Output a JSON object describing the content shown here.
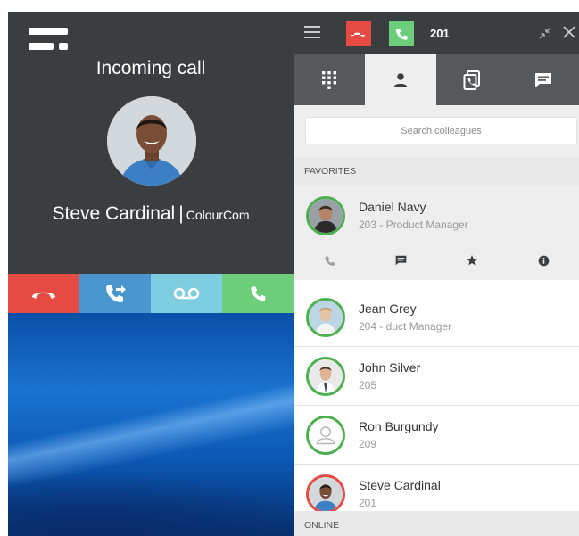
{
  "popup": {
    "title": "Incoming call",
    "caller_name": "Steve Cardinal",
    "separator": "|",
    "caller_company": "ColourCom",
    "actions": [
      {
        "id": "hangup",
        "icon": "hangup-icon",
        "color": "#e54b42"
      },
      {
        "id": "transfer",
        "icon": "transfer-call-icon",
        "color": "#4a97d0"
      },
      {
        "id": "voicemail",
        "icon": "voicemail-icon",
        "color": "#7fcde0"
      },
      {
        "id": "answer",
        "icon": "phone-icon",
        "color": "#6cce7a"
      }
    ]
  },
  "softphone": {
    "topbar": {
      "hangup_color": "#e54b42",
      "answer_color": "#6cce7a",
      "extension": "201"
    },
    "tabs": [
      {
        "id": "keypad",
        "icon": "keypad-icon",
        "active": false
      },
      {
        "id": "contacts",
        "icon": "contact-icon",
        "active": true
      },
      {
        "id": "history",
        "icon": "call-history-icon",
        "active": false
      },
      {
        "id": "chat",
        "icon": "chat-icon",
        "active": false
      }
    ],
    "search": {
      "placeholder": "Search colleagues",
      "value": ""
    },
    "sections": {
      "favorites": "FAVORITES",
      "online": "ONLINE"
    },
    "favorites": [
      {
        "name": "Daniel Navy",
        "detail": "203 - Product Manager",
        "status": "available",
        "status_color": "#4caf50",
        "expanded": true
      },
      {
        "name": "Jean Grey",
        "detail": "204 - duct Manager",
        "status": "available",
        "status_color": "#4caf50",
        "expanded": false
      },
      {
        "name": "John Silver",
        "detail": "205",
        "status": "available",
        "status_color": "#4caf50",
        "expanded": false
      },
      {
        "name": "Ron Burgundy",
        "detail": "209",
        "status": "available",
        "status_color": "#4caf50",
        "expanded": false
      },
      {
        "name": "Steve Cardinal",
        "detail": "201",
        "status": "busy",
        "status_color": "#e54b42",
        "expanded": false
      }
    ],
    "row_actions": [
      "phone-icon",
      "chat-icon",
      "star-icon",
      "info-icon"
    ]
  }
}
